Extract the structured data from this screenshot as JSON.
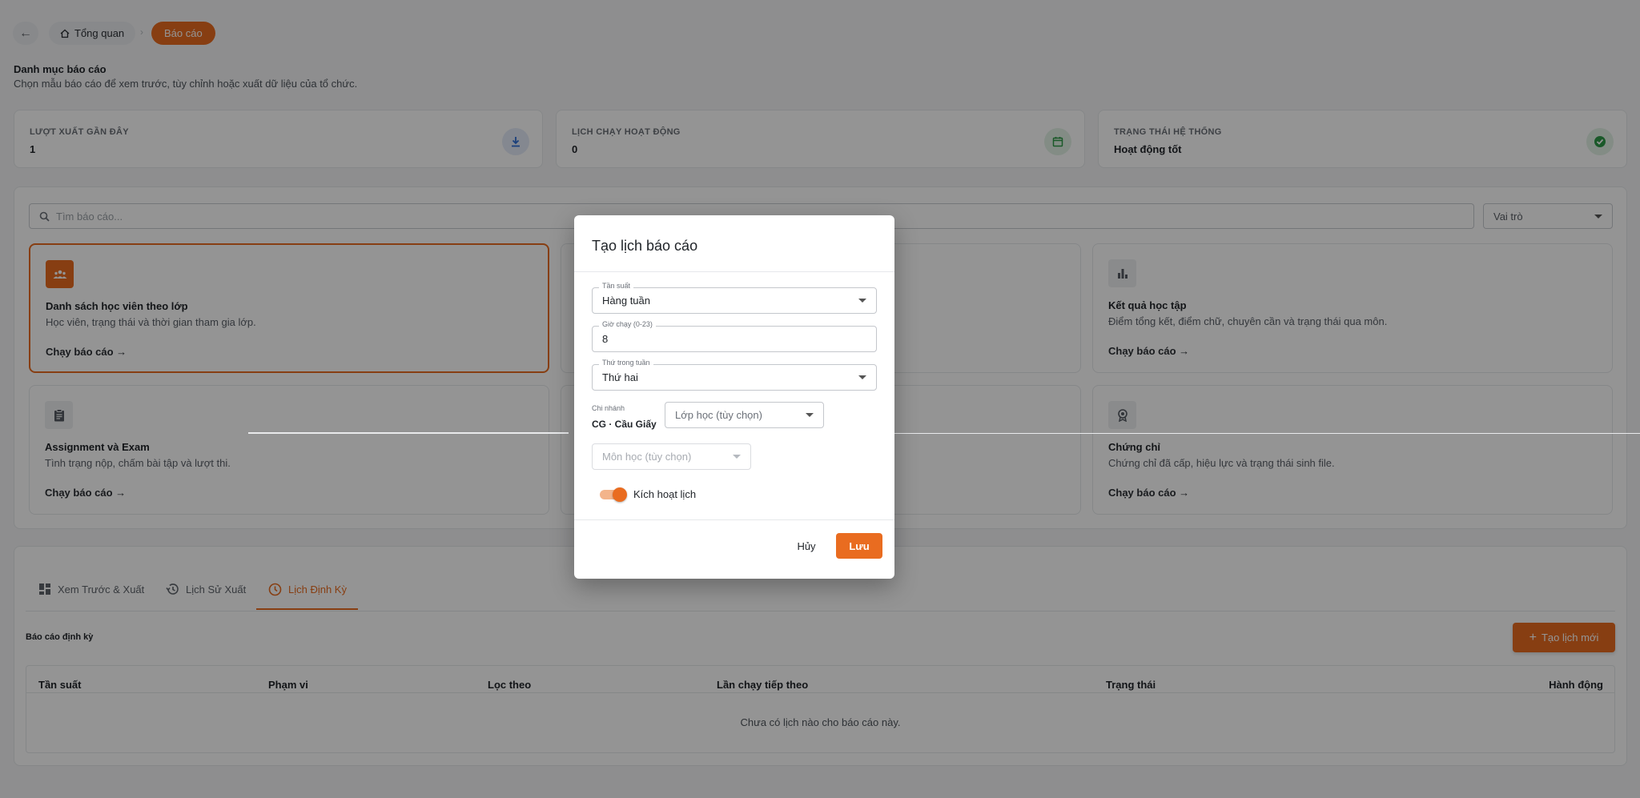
{
  "breadcrumb": {
    "home": "Tổng quan",
    "current": "Báo cáo"
  },
  "header": {
    "title": "Danh mục báo cáo",
    "subtitle": "Chọn mẫu báo cáo để xem trước, tùy chỉnh hoặc xuất dữ liệu của tổ chức."
  },
  "stats": [
    {
      "label": "LƯỢT XUẤT GẦN ĐÂY",
      "value": "1",
      "icon": "download-icon",
      "color": "#2f6fd6"
    },
    {
      "label": "LỊCH CHẠY HOẠT ĐỘNG",
      "value": "0",
      "icon": "calendar-icon",
      "color": "#2e9a48"
    },
    {
      "label": "TRẠNG THÁI HỆ THỐNG",
      "value": "Hoạt động tốt",
      "icon": "check-circle-icon",
      "color": "#2e9a48"
    }
  ],
  "filters": {
    "search_placeholder": "Tìm báo cáo...",
    "role": "Vai trò"
  },
  "cards": [
    {
      "title": "Danh sách học viên theo lớp",
      "desc": "Học viên, trạng thái và thời gian tham gia lớp.",
      "link": "Chạy báo cáo →"
    },
    {
      "title": "Kết quả học tập",
      "desc": "Điểm tổng kết, điểm chữ, chuyên cần và trạng thái qua môn.",
      "link": "Chạy báo cáo →"
    },
    {
      "title": "Assignment và Exam",
      "desc": "Tình trạng nộp, chấm bài tập và lượt thi.",
      "link": "Chạy báo cáo →"
    },
    {
      "title": "Chứng chỉ",
      "desc": "Chứng chỉ đã cấp, hiệu lực và trạng thái sinh file.",
      "link": "Chạy báo cáo →"
    }
  ],
  "tabs": [
    {
      "label": "Xem Trước & Xuất"
    },
    {
      "label": "Lịch Sử Xuất"
    },
    {
      "label": "Lịch Định Kỳ"
    }
  ],
  "schedule": {
    "label": "Báo cáo định kỳ",
    "new_button": "Tạo lịch mới",
    "columns": [
      "Tần suất",
      "Phạm vi",
      "Lọc theo",
      "Lần chạy tiếp theo",
      "Trạng thái",
      "Hành động"
    ],
    "empty": "Chưa có lịch nào cho báo cáo này."
  },
  "dialog": {
    "title": "Tạo lịch báo cáo",
    "frequency_label": "Tần suất",
    "frequency_value": "Hàng tuần",
    "hour_label": "Giờ chạy (0-23)",
    "hour_value": "8",
    "weekday_label": "Thứ trong tuần",
    "weekday_value": "Thứ hai",
    "branch_label": "Chi nhánh",
    "branch_value": "CG · Cầu Giấy",
    "class_placeholder": "Lớp học (tùy chọn)",
    "subject_placeholder": "Môn học (tùy chọn)",
    "toggle_label": "Kích hoạt lịch",
    "toggle_on": true,
    "cancel": "Hủy",
    "save": "Lưu"
  },
  "colors": {
    "accent": "#e96c20"
  }
}
